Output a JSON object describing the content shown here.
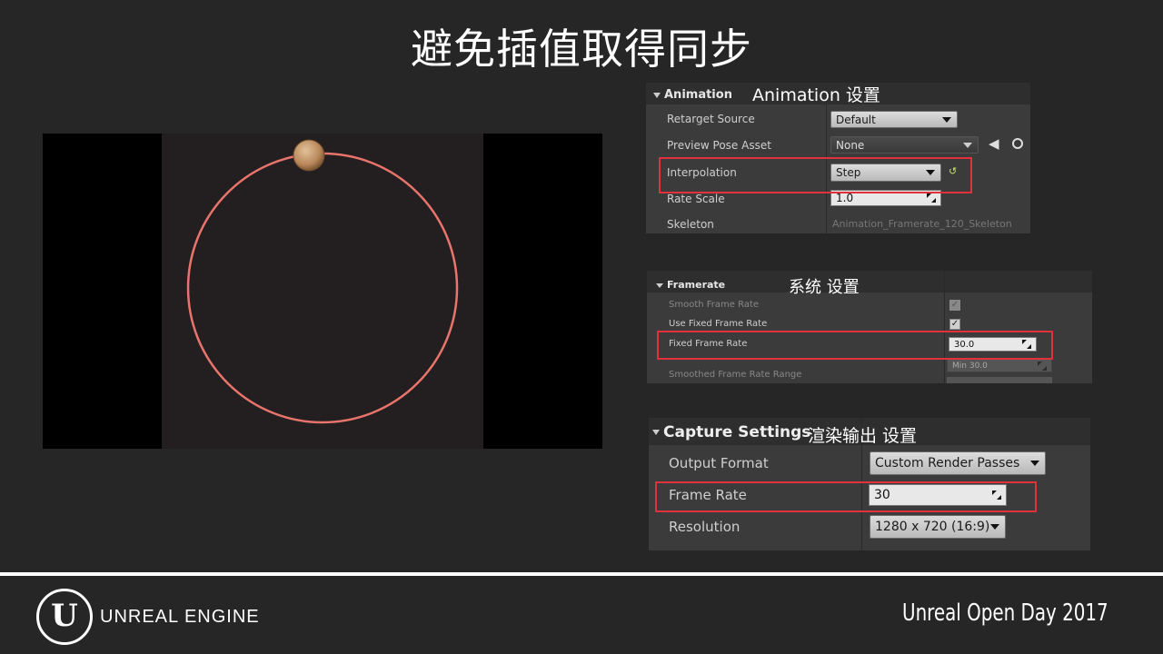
{
  "slide": {
    "title": "避免插值取得同步"
  },
  "animation_panel": {
    "header": "Animation",
    "annotation": "Animation 设置",
    "rows": [
      {
        "label": "Retarget Source",
        "value": "Default"
      },
      {
        "label": "Preview Pose Asset",
        "value": "None"
      },
      {
        "label": "Interpolation",
        "value": "Step"
      },
      {
        "label": "Rate Scale",
        "value": "1.0"
      },
      {
        "label": "Skeleton",
        "value": "Animation_Framerate_120_Skeleton"
      }
    ]
  },
  "framerate_panel": {
    "header": "Framerate",
    "annotation": "系统 设置",
    "rows": [
      {
        "label": "Smooth Frame Rate"
      },
      {
        "label": "Use Fixed Frame Rate"
      },
      {
        "label": "Fixed Frame Rate",
        "value": "30.0"
      },
      {
        "label": "Smoothed Frame Rate Range",
        "min_label": "Min",
        "min_value": "30.0"
      }
    ]
  },
  "capture_panel": {
    "header": "Capture Settings",
    "annotation": "渲染输出 设置",
    "rows": [
      {
        "label": "Output Format",
        "value": "Custom Render Passes"
      },
      {
        "label": "Frame Rate",
        "value": "30"
      },
      {
        "label": "Resolution",
        "value": "1280 x 720 (16:9)"
      }
    ]
  },
  "footer": {
    "brand": "UNREAL ENGINE",
    "event": "Unreal Open Day 2017"
  },
  "colors": {
    "highlight": "#e0323c",
    "circle": "#e8746c",
    "ball": "#b8875a"
  }
}
